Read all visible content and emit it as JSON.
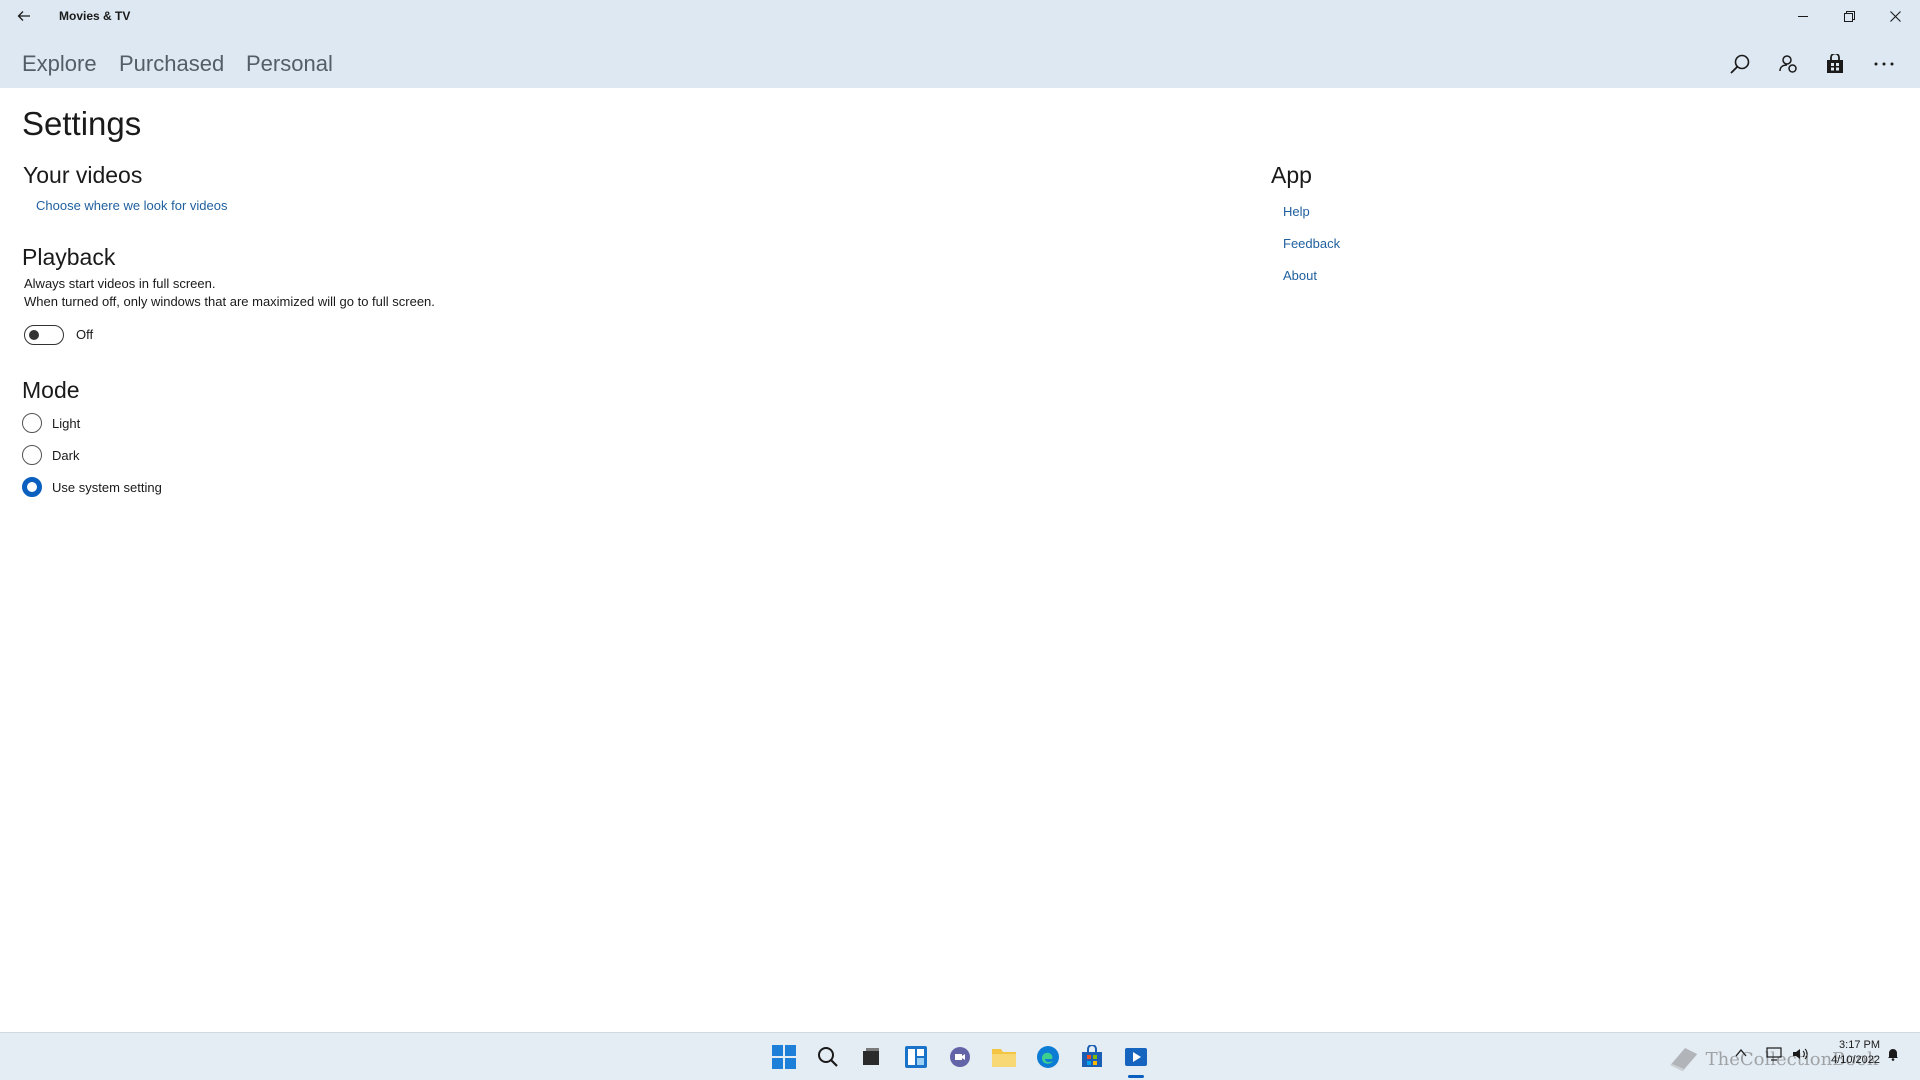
{
  "titlebar": {
    "app_title": "Movies & TV"
  },
  "nav": {
    "tabs": [
      {
        "label": "Explore"
      },
      {
        "label": "Purchased"
      },
      {
        "label": "Personal"
      }
    ]
  },
  "header_icons": [
    "search-icon",
    "account-icon",
    "store-icon",
    "more-icon"
  ],
  "settings": {
    "title": "Settings",
    "your_videos": {
      "heading": "Your videos",
      "link": "Choose where we look for videos"
    },
    "playback": {
      "heading": "Playback",
      "line1": "Always start videos in full screen.",
      "line2": "When turned off, only windows that are maximized will go to full screen.",
      "toggle_state": "Off"
    },
    "mode": {
      "heading": "Mode",
      "options": [
        {
          "label": "Light",
          "checked": false
        },
        {
          "label": "Dark",
          "checked": false
        },
        {
          "label": "Use system setting",
          "checked": true
        }
      ]
    },
    "app": {
      "heading": "App",
      "links": [
        {
          "label": "Help"
        },
        {
          "label": "Feedback"
        },
        {
          "label": "About"
        }
      ]
    }
  },
  "taskbar": {
    "clock_time": "3:17 PM",
    "clock_date": "4/10/2022",
    "watermark": "TheCollectionBook",
    "accent_color": "#0a5fbf"
  }
}
